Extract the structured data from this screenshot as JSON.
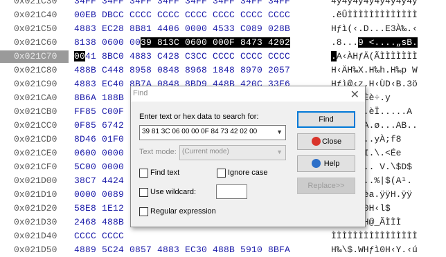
{
  "hex_view": {
    "rows": [
      {
        "addr": "0x021C30",
        "hex": "34FF 34FF 34FF 34FF 34FF 34FF 34FF 34FF",
        "ascii": "4ÿ4ÿ4ÿ4ÿ4ÿ4ÿ4ÿ4ÿ"
      },
      {
        "addr": "0x021C40",
        "hex": "00EB DBCC CCCC CCCC CCCC CCCC CCCC CCCC",
        "ascii": ".ëÛÌÌÌÌÌÌÌÌÌÌÌÌÌ"
      },
      {
        "addr": "0x021C50",
        "hex": "4883 EC28 8B81 4406 0000 4533 C089 028B",
        "ascii": "Hƒì(‹.D...E3À‰.‹"
      },
      {
        "addr": "0x021C60",
        "hex_pre": "8138 0600 00",
        "hex_sel": "39 813C 0600 000F 8473 4202",
        "hex_post": "",
        "ascii_pre": ".8...",
        "ascii_sel": "9 <....„sB.",
        "ascii_post": ""
      },
      {
        "addr": "0x021C70",
        "hex_cursor": "00",
        "hex_rest": "41 8BC0 4883 C428 C3CC CCCC CCCC CCCC",
        "ascii_cursor": ".",
        "ascii_rest": "A‹ÀHƒÄ(ÃÌÌÌÌÌÌÌ",
        "current": true
      },
      {
        "addr": "0x021C80",
        "hex": "488B C448 8958 0848 8968 1848 8970 2057",
        "ascii": "H‹ÄH‰X.H‰h.H‰p W"
      },
      {
        "addr": "0x021C90",
        "hex": "4883 EC40 8B7A 0848 8BD9 448B 420C 33F6",
        "ascii": "Hƒì@‹z.H‹ÙD‹B.3ö"
      },
      {
        "addr": "0x021CA0",
        "hex": "8B6A 188B",
        "ascii": "H%p.L‹Èè÷.y"
      },
      {
        "addr": "0x021CB0",
        "hex": "FF85 C00F",
        "ascii": "...GB..èÏ.....A"
      },
      {
        "addr": "0x021CC0",
        "hex": "0F85 6742",
        "ascii": "..gB..A.ø...AB.."
      },
      {
        "addr": "0x021CD0",
        "hex": "8D46 01F0",
        "ascii": "Áf<.....yÀ;f8"
      },
      {
        "addr": "0x021CE0",
        "hex": "0600 0000",
        "ascii": "....V.I.\\.<Ée"
      },
      {
        "addr": "0x021CF0",
        "hex": "5C00 0000",
        "ascii": "\\...<... V.\\$D$"
      },
      {
        "addr": "0x021D00",
        "hex": "38C7 4424",
        "ascii": "8ÇD$....%|$(A¹."
      },
      {
        "addr": "0x021D10",
        "hex": "0000 0089",
        "ascii": "...‰$ èa.ÿÿH.ÿÿ"
      },
      {
        "addr": "0x021D20",
        "hex": "58E8 1E12",
        "ascii": "XèH‹\\$0H‹l$"
      },
      {
        "addr": "0x021D30",
        "hex": "2468 488B",
        "ascii": "$h H‹FH@_ÃÌÌÌ"
      },
      {
        "addr": "0x021D40",
        "hex": "CCCC CCCC",
        "ascii": "ÌÌÌÌÌÌÌÌÌÌÌÌÌÌÌÌ"
      },
      {
        "addr": "0x021D50",
        "hex": "4889 5C24 0857 4883 EC30 488B 5910 8BFA",
        "ascii": "H‰\\$.WHƒì0H‹Y.‹ú"
      }
    ]
  },
  "find_dialog": {
    "title": "Find",
    "close_glyph": "✕",
    "search_label": "Enter text or hex data to search for:",
    "search_value": "39 81 3C 06 00 00 0F 84 73 42 02 00",
    "text_mode_label": "Text mode:",
    "text_mode_value": "(Current mode)",
    "find_text_label": "Find text",
    "ignore_case_label": "Ignore case",
    "use_wildcard_label": "Use wildcard:",
    "regex_label": "Regular expression",
    "buttons": {
      "find": "Find",
      "close": "Close",
      "help": "Help",
      "replace": "Replace>>"
    },
    "colors": {
      "close_icon": "#d9342b",
      "help_icon": "#2c6fc8",
      "accent": "#0078d7"
    }
  }
}
